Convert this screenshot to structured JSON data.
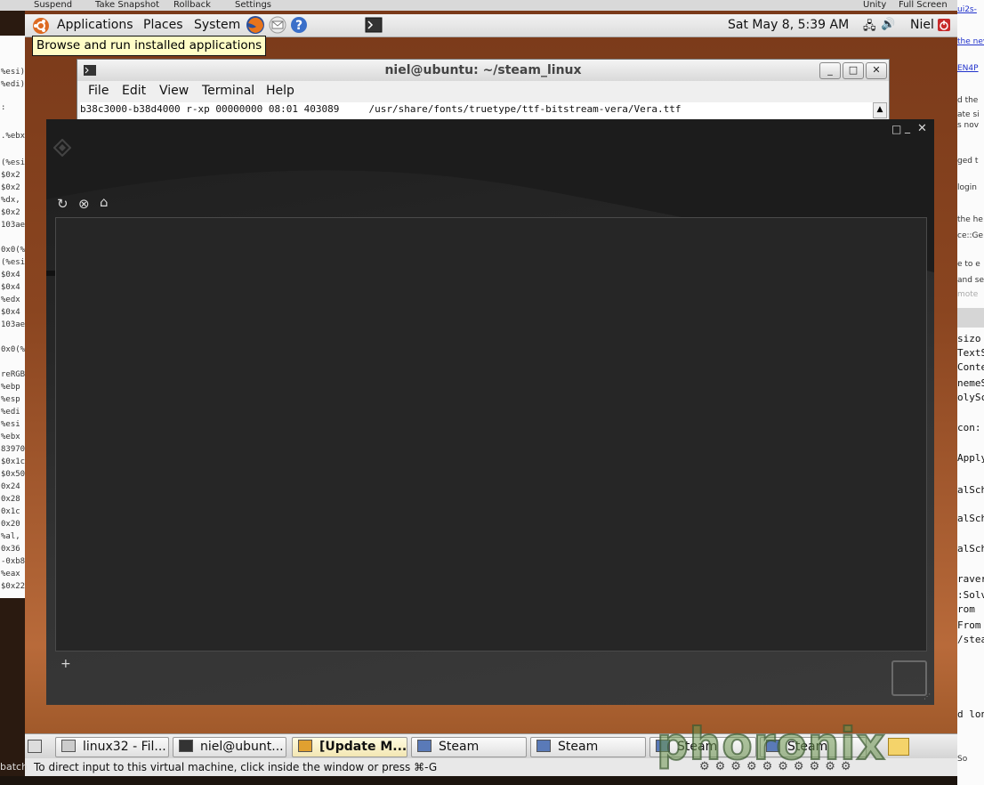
{
  "vm_toolbar": {
    "suspend": "Suspend",
    "snapshot": "Take Snapshot",
    "rollback": "Rollback",
    "settings": "Settings",
    "unity": "Unity",
    "fullscreen": "Full Screen"
  },
  "top_panel": {
    "menus": [
      "Applications",
      "Places",
      "System"
    ],
    "clock": "Sat May  8,  5:39 AM",
    "user": "Niel",
    "tooltip": "Browse and run installed applications"
  },
  "terminal": {
    "title": "niel@ubuntu: ~/steam_linux",
    "menu": [
      "File",
      "Edit",
      "View",
      "Terminal",
      "Help"
    ],
    "line": "b38c3000-b38d4000 r-xp 00000000 08:01 403089     /usr/share/fonts/truetype/ttf-bitstream-vera/Vera.ttf"
  },
  "taskbar": {
    "items": [
      "linux32 - Fil...",
      "niel@ubunt...",
      "[Update M...",
      "Steam",
      "Steam",
      "Steam",
      "Steam"
    ]
  },
  "statusbar": {
    "text": "To direct input to this virtual machine, click inside the window or press ⌘-G"
  },
  "host_left": [
    "%esi)",
    "%edi)",
    ":",
    ".%ebx",
    "(%esi",
    "$0x2",
    "$0x2",
    "%dx,",
    "$0x2",
    "103ae",
    "0x0(%",
    "(%esi",
    "$0x4",
    "$0x4",
    "%edx",
    "$0x4",
    "103ae",
    "0x0(%",
    "reRGB",
    "%ebp",
    "%esp",
    "%edi",
    "%esi",
    "%ebx",
    "83970",
    "$0x1c",
    "$0x50",
    "0x24",
    "0x28",
    "0x1c",
    "0x20",
    "%al,",
    "0x36",
    "-0xb8",
    "%eax",
    "$0x22"
  ],
  "host_right": [
    "ui2s-",
    "the nev",
    "EN4P",
    "d the",
    "ate si",
    "s nov",
    "ged t",
    "login",
    "the he",
    "ce::Ge",
    "e to e",
    "and se",
    "mote",
    "sizo",
    "TextS",
    "Conte",
    "nemeS",
    "olySc",
    "con:",
    "Apply",
    "alSch",
    "alSch",
    "alSch",
    "raver",
    ":Solv",
    "rom ",
    "From ",
    "/stea",
    "d lon",
    "So"
  ],
  "host_left_bottom": "batch",
  "watermark": "phoronix",
  "icons": {
    "apps": "ubuntu-logo-icon",
    "browser": "firefox-icon",
    "mail": "mail-icon",
    "help": "help-icon",
    "terminal": "terminal-icon"
  }
}
